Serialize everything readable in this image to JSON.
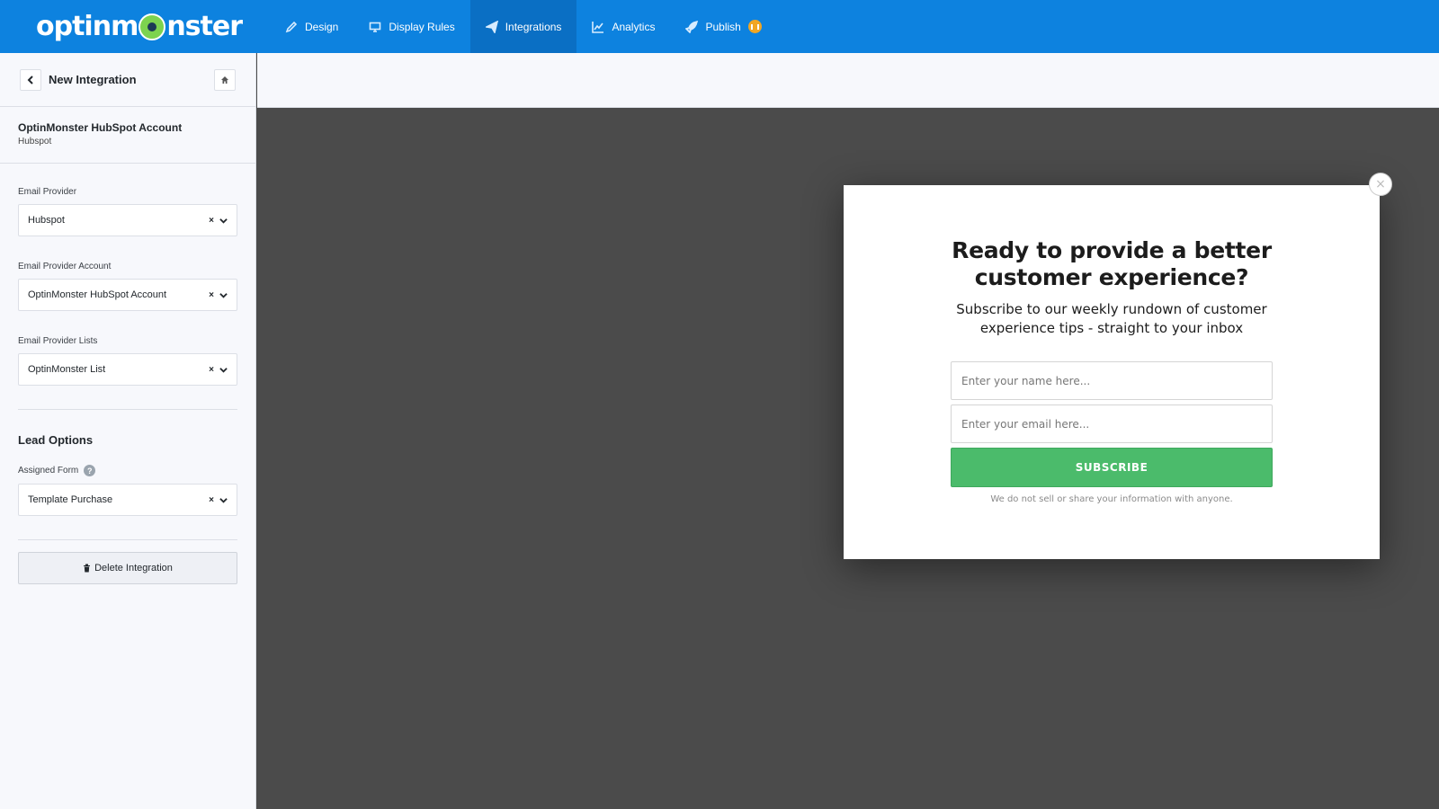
{
  "brand": {
    "logo_left": "optinm",
    "logo_right": "nster"
  },
  "nav": {
    "items": [
      {
        "label": "Design",
        "icon": "pencil-icon"
      },
      {
        "label": "Display Rules",
        "icon": "monitor-icon"
      },
      {
        "label": "Integrations",
        "icon": "paper-plane-icon"
      },
      {
        "label": "Analytics",
        "icon": "chart-line-icon"
      },
      {
        "label": "Publish",
        "icon": "rocket-icon"
      }
    ],
    "active": "Integrations"
  },
  "sidebar": {
    "title": "New Integration",
    "account": {
      "name": "OptinMonster HubSpot Account",
      "type": "Hubspot"
    },
    "fields": {
      "email_provider": {
        "label": "Email Provider",
        "value": "Hubspot"
      },
      "provider_account": {
        "label": "Email Provider Account",
        "value": "OptinMonster HubSpot Account"
      },
      "provider_lists": {
        "label": "Email Provider Lists",
        "value": "OptinMonster List"
      }
    },
    "lead_options": {
      "title": "Lead Options",
      "assigned_form": {
        "label": "Assigned Form",
        "value": "Template Purchase",
        "help": "?"
      }
    },
    "delete_label": "Delete Integration",
    "clear_glyph": "×"
  },
  "popup": {
    "title": "Ready to provide a better customer experience?",
    "subtitle": "Subscribe to our weekly rundown of customer experience tips - straight to your inbox",
    "name_placeholder": "Enter your name here...",
    "email_placeholder": "Enter your email here...",
    "submit_label": "SUBSCRIBE",
    "privacy_note": "We do not sell or share your information with anyone.",
    "close_glyph": "×"
  },
  "colors": {
    "topbar": "#0d82df",
    "active_tab": "#0a6fc4",
    "subscribe": "#4bbb6b",
    "badge": "#f1a623",
    "canvas": "#4b4b4b"
  }
}
